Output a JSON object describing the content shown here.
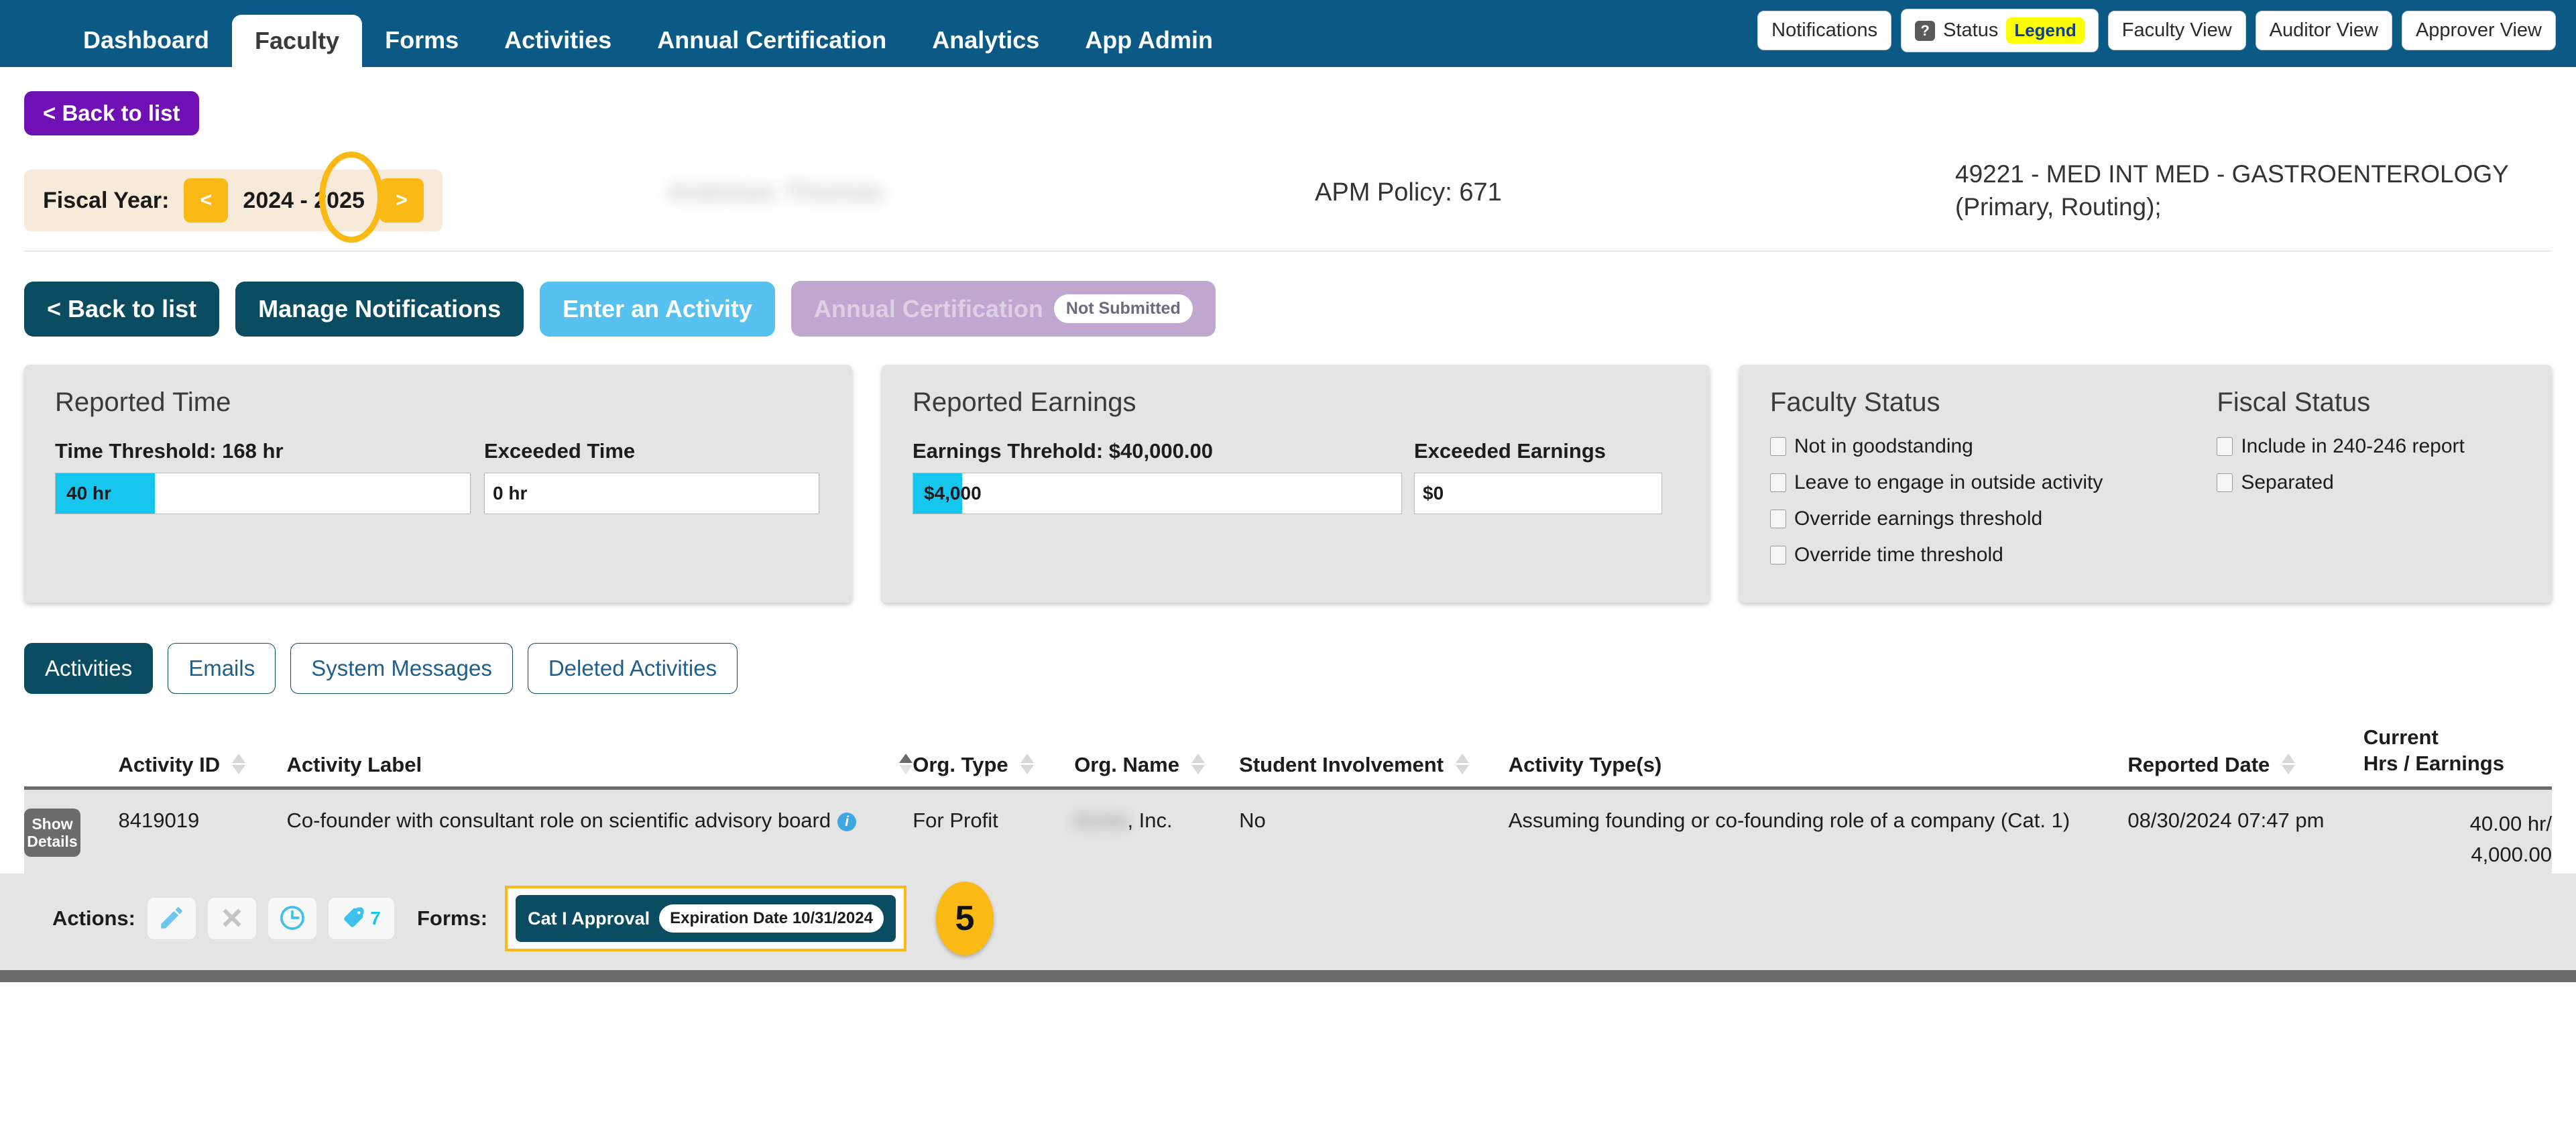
{
  "nav": {
    "items": [
      {
        "label": "Dashboard",
        "active": false
      },
      {
        "label": "Faculty",
        "active": true
      },
      {
        "label": "Forms",
        "active": false
      },
      {
        "label": "Activities",
        "active": false
      },
      {
        "label": "Annual Certification",
        "active": false
      },
      {
        "label": "Analytics",
        "active": false
      },
      {
        "label": "App Admin",
        "active": false
      }
    ],
    "right": {
      "notifications": "Notifications",
      "status": "Status",
      "legend": "Legend",
      "faculty_view": "Faculty View",
      "auditor_view": "Auditor View",
      "approver_view": "Approver View"
    }
  },
  "back_to_list_top": "< Back to list",
  "fiscal": {
    "label": "Fiscal Year:",
    "prev": "<",
    "next": ">",
    "value": "2024 - 2025"
  },
  "header": {
    "faculty_name": "Andrews Thomas",
    "apm_policy": "APM Policy: 671",
    "department": "49221 - MED INT MED - GASTROENTEROLOGY (Primary, Routing);"
  },
  "actions": {
    "back_to_list": "< Back to list",
    "manage_notifications": "Manage Notifications",
    "enter_activity": "Enter an Activity",
    "annual_certification": "Annual Certification",
    "annual_certification_status": "Not Submitted"
  },
  "reported_time": {
    "title": "Reported Time",
    "threshold_label": "Time Threshold: 168 hr",
    "used_value": "40 hr",
    "used_percent": 24,
    "exceeded_label": "Exceeded Time",
    "exceeded_value": "0 hr"
  },
  "reported_earnings": {
    "title": "Reported Earnings",
    "threshold_label": "Earnings Threhold: $40,000.00",
    "used_value": "$4,000",
    "used_percent": 10,
    "exceeded_label": "Exceeded Earnings",
    "exceeded_value": "$0"
  },
  "faculty_status": {
    "title": "Faculty Status",
    "items": [
      {
        "label": "Not in goodstanding",
        "checked": false
      },
      {
        "label": "Leave to engage in outside activity",
        "checked": false
      },
      {
        "label": "Override earnings threshold",
        "checked": false
      },
      {
        "label": "Override time threshold",
        "checked": false
      }
    ]
  },
  "fiscal_status": {
    "title": "Fiscal Status",
    "items": [
      {
        "label": "Include in 240-246 report",
        "checked": false
      },
      {
        "label": "Separated",
        "checked": false
      }
    ]
  },
  "tabs": [
    {
      "label": "Activities",
      "active": true
    },
    {
      "label": "Emails",
      "active": false
    },
    {
      "label": "System Messages",
      "active": false
    },
    {
      "label": "Deleted Activities",
      "active": false
    }
  ],
  "table": {
    "columns": [
      {
        "label": "Activity ID",
        "sortable": true,
        "sort": "none"
      },
      {
        "label": "Activity Label",
        "sortable": true,
        "sort": "asc"
      },
      {
        "label": "Org. Type",
        "sortable": true,
        "sort": "none"
      },
      {
        "label": "Org. Name",
        "sortable": true,
        "sort": "none"
      },
      {
        "label": "Student Involvement",
        "sortable": true,
        "sort": "none"
      },
      {
        "label": "Activity Type(s)",
        "sortable": false,
        "sort": "none"
      },
      {
        "label": "Reported Date",
        "sortable": true,
        "sort": "none"
      },
      {
        "label": "Current Hrs / Earnings",
        "sortable": false,
        "sort": "none"
      }
    ],
    "column_header_current": "Current",
    "column_header_hrs": "Hrs / Earnings",
    "rows": [
      {
        "show_details": "Show Details",
        "activity_id": "8419019",
        "activity_label": "Co-founder with consultant role on scientific advisory board",
        "org_type": "For Profit",
        "org_name_blurred": "Acme",
        "org_name_suffix": ", Inc.",
        "student_involvement": "No",
        "activity_types": "Assuming founding or co-founding role of a company (Cat. 1)",
        "reported_date": "08/30/2024 07:47 pm",
        "current_hrs": "40.00 hr/",
        "current_earnings": "4,000.00"
      }
    ]
  },
  "row_actions": {
    "actions_label": "Actions:",
    "edit_icon": "pencil-icon",
    "delete_icon": "x-icon",
    "history_icon": "clock-icon",
    "tag_icon": "tag-icon",
    "tag_count": "7",
    "forms_label": "Forms:",
    "form_name": "Cat I Approval",
    "form_expiration": "Expiration Date 10/31/2024",
    "step_number": "5"
  },
  "colors": {
    "navbar": "#0b5a86",
    "accent_teal": "#0a4d63",
    "accent_yellow": "#fbb915",
    "accent_cyan": "#16c6ee",
    "purple": "#6f10b5",
    "panel_bg": "#e4e4e4"
  }
}
